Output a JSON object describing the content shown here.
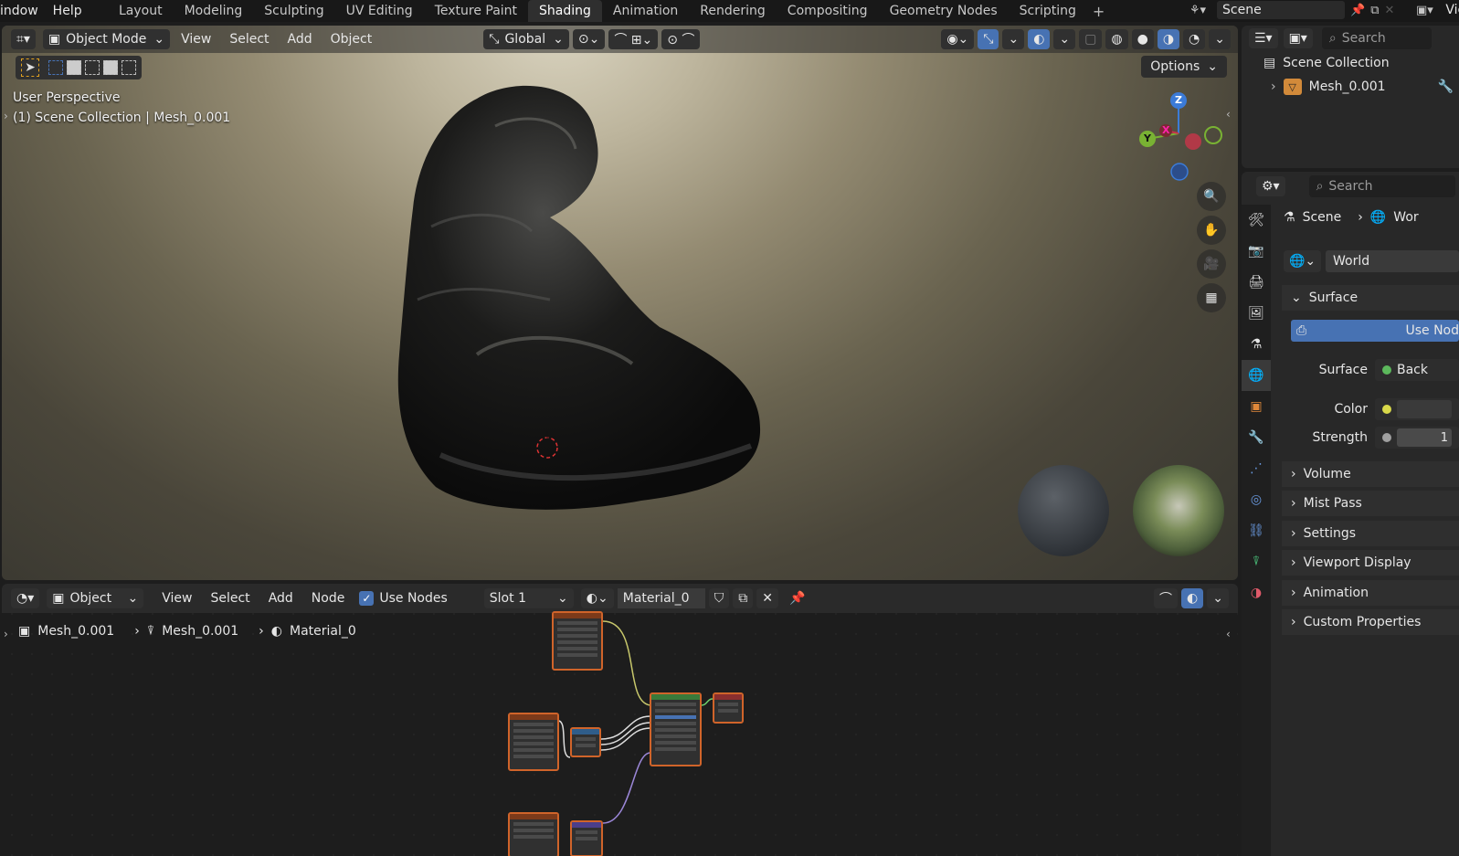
{
  "topbar": {
    "menus": [
      "indow",
      "Help"
    ],
    "workspaces": [
      "Layout",
      "Modeling",
      "Sculpting",
      "UV Editing",
      "Texture Paint",
      "Shading",
      "Animation",
      "Rendering",
      "Compositing",
      "Geometry Nodes",
      "Scripting"
    ],
    "active_workspace": "Shading",
    "scene_name": "Scene",
    "view_layer_label": "View"
  },
  "viewport": {
    "mode": "Object Mode",
    "menus": [
      "View",
      "Select",
      "Add",
      "Object"
    ],
    "orientation": "Global",
    "options_label": "Options",
    "perspective_label": "User Perspective",
    "collection_label": "(1) Scene Collection | Mesh_0.001",
    "gizmo": {
      "z": "Z",
      "y": "Y",
      "x": "X"
    }
  },
  "node_editor": {
    "mode": "Object",
    "menus": [
      "View",
      "Select",
      "Add",
      "Node"
    ],
    "use_nodes_label": "Use Nodes",
    "use_nodes_checked": true,
    "slot": "Slot 1",
    "material": "Material_0",
    "breadcrumb": [
      "Mesh_0.001",
      "Mesh_0.001",
      "Material_0"
    ]
  },
  "outliner": {
    "search_placeholder": "Search",
    "root": "Scene Collection",
    "item": "Mesh_0.001"
  },
  "properties": {
    "search_placeholder": "Search",
    "breadcrumb": [
      "Scene",
      "Wor"
    ],
    "world_name": "World",
    "surface_section": "Surface",
    "use_nodes_button": "Use Nod",
    "surface_label": "Surface",
    "surface_value": "Back",
    "color_label": "Color",
    "strength_label": "Strength",
    "strength_value": "1",
    "sections": [
      "Volume",
      "Mist Pass",
      "Settings",
      "Viewport Display",
      "Animation",
      "Custom Properties"
    ]
  },
  "colors": {
    "accent_blue": "#4772b3",
    "node_border": "#d0642a",
    "surface_dot": "#5cb85c",
    "color_dot": "#d9d94a"
  }
}
